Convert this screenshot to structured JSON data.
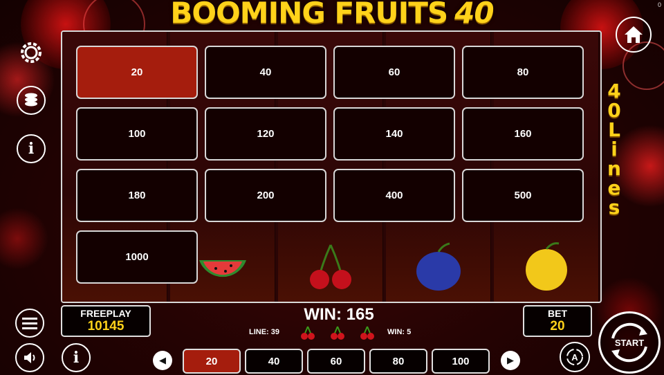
{
  "game": {
    "title": "BOOMING FRUITS",
    "title_number": "40",
    "corner_value": "0"
  },
  "lines_label": [
    "4",
    "0",
    "L",
    "i",
    "n",
    "e",
    "s"
  ],
  "grid": {
    "options": [
      "20",
      "40",
      "60",
      "80",
      "100",
      "120",
      "140",
      "160",
      "180",
      "200",
      "400",
      "500",
      "1000"
    ],
    "selected": "20"
  },
  "freeplay": {
    "label": "FREEPLAY",
    "value": "10145"
  },
  "bet": {
    "label": "BET",
    "value": "20"
  },
  "win": {
    "label": "WIN: 165",
    "line": "LINE: 39",
    "line_win": "WIN: 5"
  },
  "bet_selector": {
    "options": [
      "20",
      "40",
      "60",
      "80",
      "100"
    ],
    "selected": "20"
  },
  "start": {
    "label": "START"
  },
  "icons": {
    "settings": "gear-icon",
    "coins": "coins-icon",
    "info": "info-icon",
    "menu": "menu-icon",
    "sound": "speaker-icon",
    "home": "home-icon",
    "cherry": "cherry-icon",
    "auto": "autoplay-icon"
  },
  "colors": {
    "accent_gold": "#ffd21a",
    "selected_red": "#a51d0d",
    "panel_bg": "#130000"
  }
}
